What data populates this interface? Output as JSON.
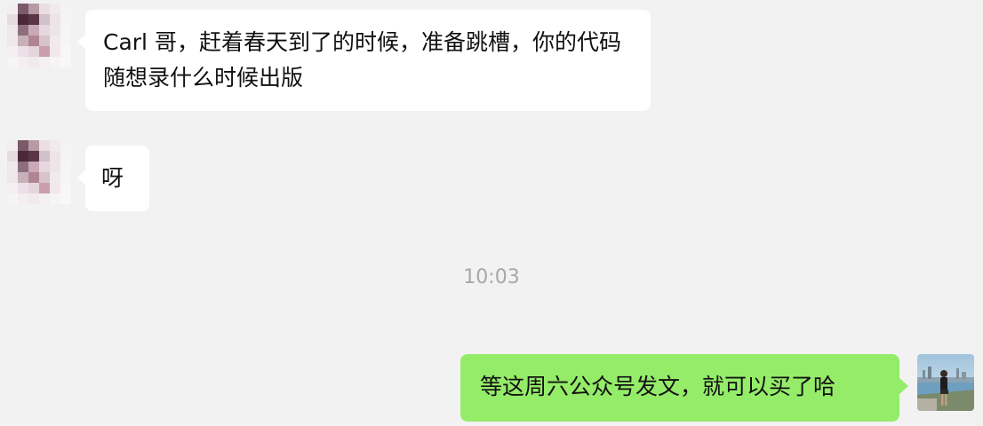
{
  "messages": [
    {
      "sender": "other",
      "text": "Carl 哥，赶着春天到了的时候，准备跳槽，你的代码随想录什么时候出版"
    },
    {
      "sender": "other",
      "text": "呀"
    },
    {
      "sender": "self",
      "text": "等这周六公众号发文，就可以买了哈"
    }
  ],
  "timestamp": "10:03",
  "colors": {
    "background": "#f2f2f2",
    "incoming_bubble": "#ffffff",
    "outgoing_bubble": "#95ec69",
    "timestamp_text": "#a7a7a7"
  }
}
